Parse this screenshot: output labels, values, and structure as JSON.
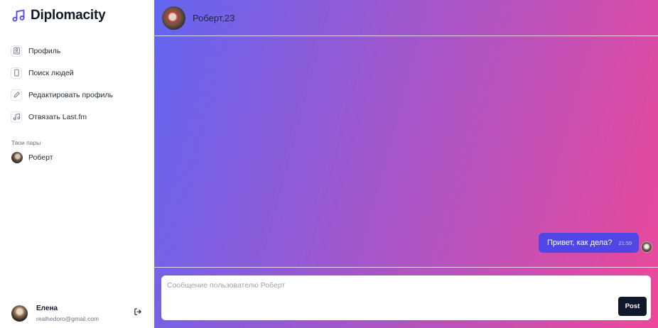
{
  "app": {
    "name": "Diplomacity",
    "brand_icon": "music-note-icon",
    "accent": "#4f46e5"
  },
  "nav": {
    "items": [
      {
        "label": "Профиль",
        "icon": "profile-icon"
      },
      {
        "label": "Поиск людей",
        "icon": "phone-icon"
      },
      {
        "label": "Редактировать профиль",
        "icon": "pencil-icon"
      },
      {
        "label": "Отвязать Last.fm",
        "icon": "music-note-icon"
      }
    ]
  },
  "pairs": {
    "title": "Твои пары",
    "items": [
      {
        "name": "Роберт"
      }
    ]
  },
  "current_user": {
    "name": "Елена",
    "email": "realhedoro@gmail.com",
    "logout_icon": "logout-icon"
  },
  "chat": {
    "title": "Роберт,23",
    "messages": [
      {
        "text": "Привет, как дела?",
        "time": "21:59",
        "from_me": true
      }
    ],
    "composer": {
      "placeholder": "Сообщение пользователю Роберт",
      "value": "",
      "post_label": "Post"
    },
    "gradient": [
      "#6366f1",
      "#a855c8",
      "#ec4899"
    ]
  }
}
